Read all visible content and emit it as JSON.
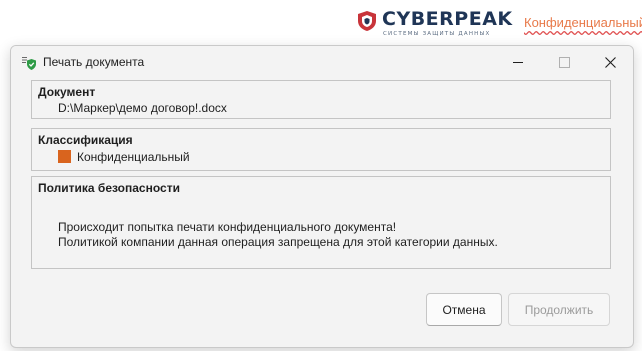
{
  "background": {
    "brand": "CYBERPEAK",
    "tagline": "СИСТЕМЫ ЗАЩИТЫ ДАННЫХ",
    "classification_label": "Конфиденциальный"
  },
  "dialog": {
    "title": "Печать документа",
    "document": {
      "heading": "Документ",
      "path": "D:\\Маркер\\демо договор!.docx"
    },
    "classification": {
      "heading": "Классификация",
      "value": "Конфиденциальный",
      "color": "#d9641e"
    },
    "policy": {
      "heading": "Политика безопасности",
      "line1": "Происходит попытка печати конфиденциального документа!",
      "line2": "Политикой компании данная операция запрещена для этой категории данных."
    },
    "buttons": {
      "cancel": "Отмена",
      "continue": "Продолжить"
    }
  },
  "colors": {
    "brand_navy": "#1f3556",
    "brand_red": "#c8343a",
    "classification_orange": "#d9641e",
    "shield_green": "#2e9b46"
  }
}
